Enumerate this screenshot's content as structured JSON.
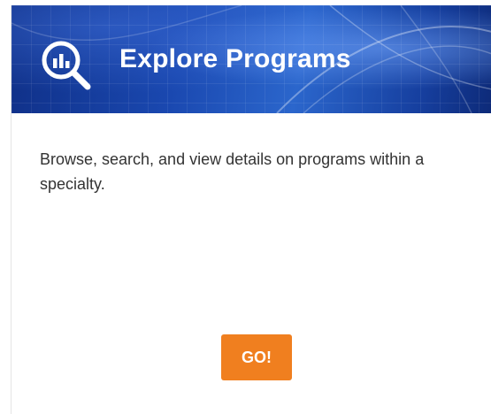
{
  "card": {
    "icon": "search-chart-icon",
    "title": "Explore Programs",
    "description": "Browse, search, and view details on programs within a specialty.",
    "button_label": "GO!"
  },
  "colors": {
    "header_primary": "#1a48b0",
    "header_dark": "#0d2a78",
    "button": "#f07f1f",
    "text": "#333333"
  }
}
